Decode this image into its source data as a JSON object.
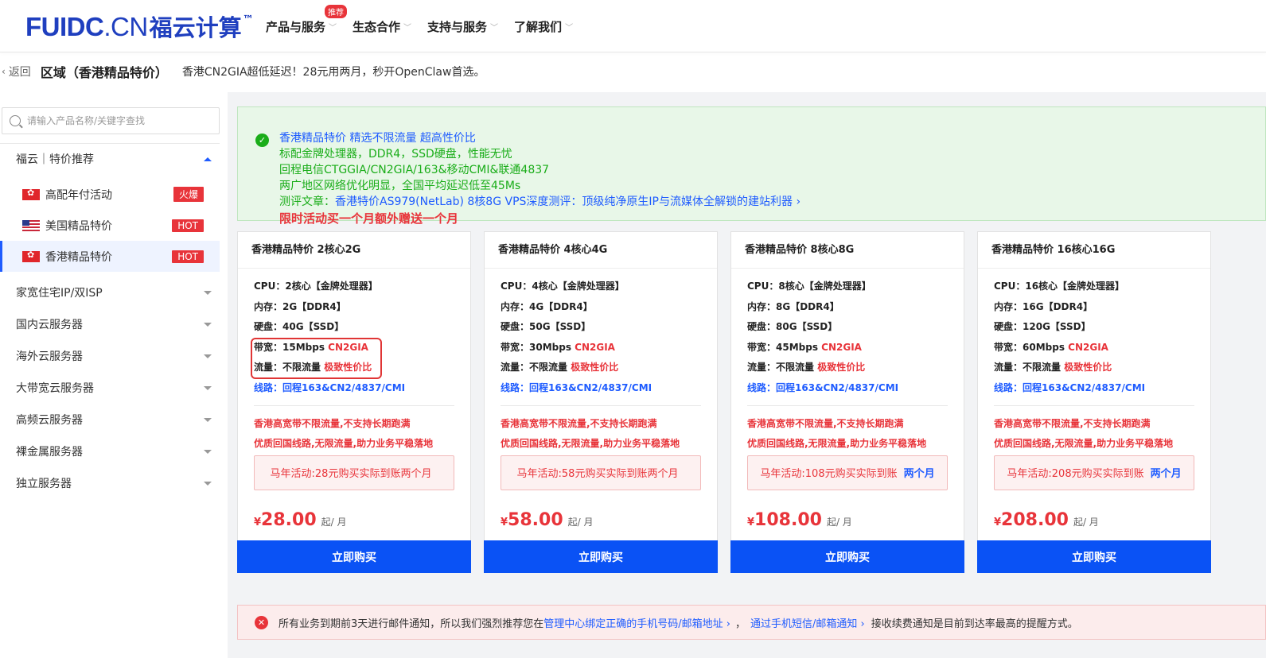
{
  "header": {
    "logo_main": "FUIDC",
    "logo_dot": ".CN",
    "logo_cn": "福云计算",
    "logo_tm": "™",
    "nav": [
      {
        "label": "产品与服务",
        "badge": "推荐"
      },
      {
        "label": "生态合作"
      },
      {
        "label": "支持与服务"
      },
      {
        "label": "了解我们"
      }
    ]
  },
  "breadcrumb": {
    "back_label": "返回",
    "title": "区域（香港精品特价）",
    "subtitle": "香港CN2GIA超低延迟！28元用两月，秒开OpenClaw首选。"
  },
  "sidebar": {
    "search_placeholder": "请输入产品名称/关键字查找",
    "group_open": "福云｜特价推荐",
    "sub_items": [
      {
        "label": "高配年付活动",
        "badge": "火爆",
        "flag": "hk"
      },
      {
        "label": "美国精品特价",
        "badge": "HOT",
        "flag": "us"
      },
      {
        "label": "香港精品特价",
        "badge": "HOT",
        "flag": "hk",
        "active": true
      }
    ],
    "groups": [
      "家宽住宅IP/双ISP",
      "国内云服务器",
      "海外云服务器",
      "大带宽云服务器",
      "高频云服务器",
      "裸金属服务器",
      "独立服务器"
    ]
  },
  "notice": {
    "line1": "香港精品特价 精选不限流量 超高性价比",
    "line2": "标配金牌处理器，DDR4，SSD硬盘，性能无忧",
    "line3": "回程电信CTGGIA/CN2GIA/163&移动CMI&联通4837",
    "line4": "两广地区网络优化明显，全国平均延迟低至45Ms",
    "line5_label": "测评文章：",
    "line5_link": "香港特价AS979(NetLab) 8核8G VPS深度测评：顶级纯净原生IP与流媒体全解锁的建站利器 ›",
    "line6": "限时活动买一个月额外赠送一个月"
  },
  "spec_labels": {
    "cpu": "CPU：",
    "mem": "内存：",
    "disk": "硬盘：",
    "bw": "带宽：",
    "traffic": "流量：",
    "route": "线路："
  },
  "cards": [
    {
      "title": "香港精品特价 2核心2G",
      "cpu": "2核心【金牌处理器】",
      "mem": "2G【DDR4】",
      "disk": "40G【SSD】",
      "bw": "15Mbps ",
      "bw_red": "CN2GIA",
      "traffic": "不限流量 ",
      "traffic_red": "极致性价比",
      "route": "回程163&CN2/4837/CMI",
      "promo1": "香港高宽带不限流量,不支持长期跑满",
      "promo2": "优质回国线路,无限流量,助力业务平稳落地",
      "promo_box": "马年活动:28元购买实际到账两个月",
      "promo_box_blue": "",
      "price_cur": "¥",
      "price": "28.00",
      "unit": "起/ 月",
      "buy": "立即购买"
    },
    {
      "title": "香港精品特价 4核心4G",
      "cpu": "4核心【金牌处理器】",
      "mem": "4G【DDR4】",
      "disk": "50G【SSD】",
      "bw": "30Mbps ",
      "bw_red": "CN2GIA",
      "traffic": "不限流量 ",
      "traffic_red": "极致性价比",
      "route": "回程163&CN2/4837/CMI",
      "promo1": "香港高宽带不限流量,不支持长期跑满",
      "promo2": "优质回国线路,无限流量,助力业务平稳落地",
      "promo_box": "马年活动:58元购买实际到账两个月",
      "promo_box_blue": "",
      "price_cur": "¥",
      "price": "58.00",
      "unit": "起/ 月",
      "buy": "立即购买"
    },
    {
      "title": "香港精品特价 8核心8G",
      "cpu": "8核心【金牌处理器】",
      "mem": "8G【DDR4】",
      "disk": "80G【SSD】",
      "bw": "45Mbps ",
      "bw_red": "CN2GIA",
      "traffic": "不限流量 ",
      "traffic_red": "极致性价比",
      "route": "回程163&CN2/4837/CMI",
      "promo1": "香港高宽带不限流量,不支持长期跑满",
      "promo2": "优质回国线路,无限流量,助力业务平稳落地",
      "promo_box": "马年活动:108元购买实际到账",
      "promo_box_blue": "两个月",
      "price_cur": "¥",
      "price": "108.00",
      "unit": "起/ 月",
      "buy": "立即购买"
    },
    {
      "title": "香港精品特价 16核心16G",
      "cpu": "16核心【金牌处理器】",
      "mem": "16G【DDR4】",
      "disk": "120G【SSD】",
      "bw": "60Mbps ",
      "bw_red": "CN2GIA",
      "traffic": "不限流量 ",
      "traffic_red": "极致性价比",
      "route": "回程163&CN2/4837/CMI",
      "promo1": "香港高宽带不限流量,不支持长期跑满",
      "promo2": "优质回国线路,无限流量,助力业务平稳落地",
      "promo_box": "马年活动:208元购买实际到账",
      "promo_box_blue": "两个月",
      "price_cur": "¥",
      "price": "208.00",
      "unit": "起/ 月",
      "buy": "立即购买"
    }
  ],
  "alert": {
    "text1": "所有业务到期前3天进行邮件通知，所以我们强烈推荐您在",
    "link1": "管理中心绑定正确的手机号码/邮箱地址 ›",
    "text2": "，",
    "link2": "通过手机短信/邮箱通知 ›",
    "text3": "接收续费通知是目前到达率最高的提醒方式。"
  },
  "colors": {
    "brand": "#1f3fbf",
    "accent": "#0a52f5",
    "danger": "#e8343a",
    "success": "#1aad19"
  }
}
